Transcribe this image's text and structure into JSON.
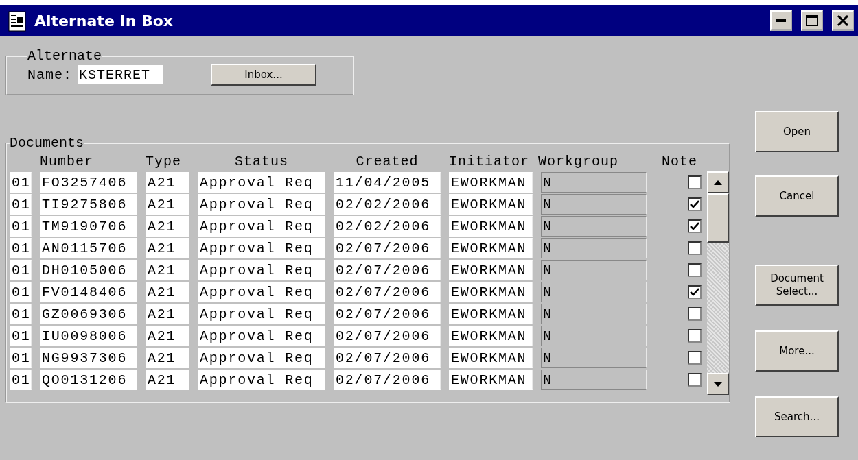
{
  "window": {
    "title": "Alternate In Box"
  },
  "alternate": {
    "legend": "Alternate",
    "name_label": "Name:",
    "name_value": "KSTERRET",
    "inbox_button": "Inbox..."
  },
  "documents": {
    "legend": "Documents",
    "columns": [
      "Number",
      "Type",
      "Status",
      "Created",
      "Initiator",
      "Workgroup",
      "Note"
    ],
    "rows": [
      {
        "seq": "01",
        "number": "FO3257406",
        "type": "A21",
        "status": "Approval Req",
        "created": "11/04/2005",
        "initiator": "EWORKMAN",
        "workgroup": "N",
        "note": false
      },
      {
        "seq": "01",
        "number": "TI9275806",
        "type": "A21",
        "status": "Approval Req",
        "created": "02/02/2006",
        "initiator": "EWORKMAN",
        "workgroup": "N",
        "note": true
      },
      {
        "seq": "01",
        "number": "TM9190706",
        "type": "A21",
        "status": "Approval Req",
        "created": "02/02/2006",
        "initiator": "EWORKMAN",
        "workgroup": "N",
        "note": true
      },
      {
        "seq": "01",
        "number": "AN0115706",
        "type": "A21",
        "status": "Approval Req",
        "created": "02/07/2006",
        "initiator": "EWORKMAN",
        "workgroup": "N",
        "note": false
      },
      {
        "seq": "01",
        "number": "DH0105006",
        "type": "A21",
        "status": "Approval Req",
        "created": "02/07/2006",
        "initiator": "EWORKMAN",
        "workgroup": "N",
        "note": false
      },
      {
        "seq": "01",
        "number": "FV0148406",
        "type": "A21",
        "status": "Approval Req",
        "created": "02/07/2006",
        "initiator": "EWORKMAN",
        "workgroup": "N",
        "note": true
      },
      {
        "seq": "01",
        "number": "GZ0069306",
        "type": "A21",
        "status": "Approval Req",
        "created": "02/07/2006",
        "initiator": "EWORKMAN",
        "workgroup": "N",
        "note": false
      },
      {
        "seq": "01",
        "number": "IU0098006",
        "type": "A21",
        "status": "Approval Req",
        "created": "02/07/2006",
        "initiator": "EWORKMAN",
        "workgroup": "N",
        "note": false
      },
      {
        "seq": "01",
        "number": "NG9937306",
        "type": "A21",
        "status": "Approval Req",
        "created": "02/07/2006",
        "initiator": "EWORKMAN",
        "workgroup": "N",
        "note": false
      },
      {
        "seq": "01",
        "number": "QO0131206",
        "type": "A21",
        "status": "Approval Req",
        "created": "02/07/2006",
        "initiator": "EWORKMAN",
        "workgroup": "N",
        "note": false
      }
    ]
  },
  "buttons": [
    {
      "label": "Open"
    },
    {
      "label": "Cancel"
    },
    {
      "label": "Document Select..."
    },
    {
      "label": "More..."
    },
    {
      "label": "Search..."
    }
  ]
}
